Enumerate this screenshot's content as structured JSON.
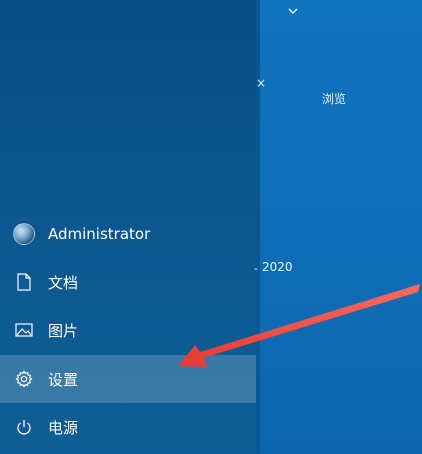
{
  "start_menu": {
    "items": [
      {
        "label": "Administrator",
        "icon": "user-avatar-icon"
      },
      {
        "label": "文档",
        "icon": "document-icon"
      },
      {
        "label": "图片",
        "icon": "image-icon"
      },
      {
        "label": "设置",
        "icon": "gear-icon",
        "highlighted": true
      },
      {
        "label": "电源",
        "icon": "power-icon"
      }
    ]
  },
  "tiles_peek": {
    "browse_label": "浏览",
    "year_text": "2020",
    "separator_text": "-",
    "close_glyph": "×",
    "chevron": "chevron-down-icon"
  },
  "annotation": {
    "arrow_color": "#e53935"
  },
  "colors": {
    "panel": "#0c578f",
    "tiles": "#0f6cb5",
    "highlight": "rgba(255,255,255,0.18)"
  }
}
